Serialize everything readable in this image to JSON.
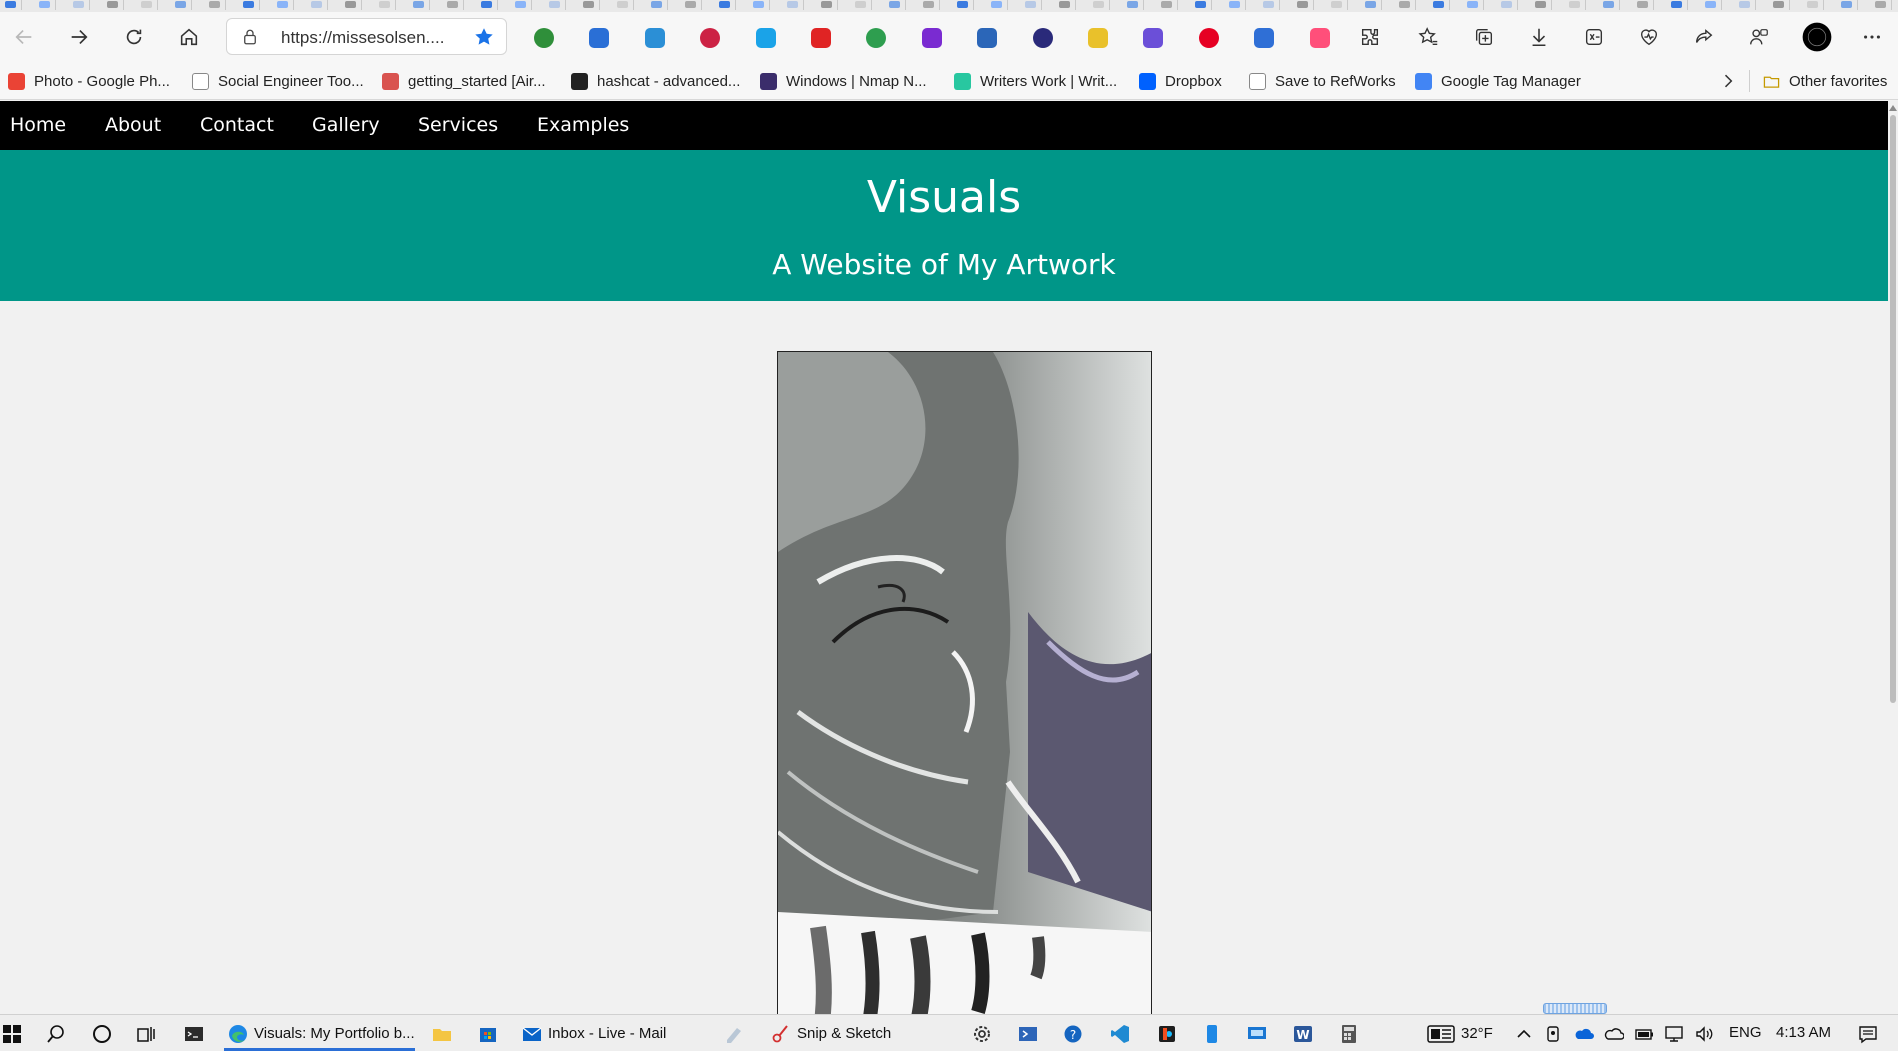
{
  "browser": {
    "url": "https://missesolsen....",
    "favorites": [
      {
        "label": "Photo - Google Ph...",
        "color": "#ea4335"
      },
      {
        "label": "Social Engineer Too...",
        "color": "#ffffff"
      },
      {
        "label": "getting_started [Air...",
        "color": "#d9534f"
      },
      {
        "label": "hashcat - advanced...",
        "color": "#222222"
      },
      {
        "label": "Windows | Nmap N...",
        "color": "#3b2d6b"
      },
      {
        "label": "Writers Work | Writ...",
        "color": "#28c7a0"
      },
      {
        "label": "Dropbox",
        "color": "#0061fe"
      },
      {
        "label": "Save to RefWorks",
        "color": "#ffffff"
      },
      {
        "label": "Google Tag Manager",
        "color": "#4285f4"
      }
    ],
    "other_favorites": "Other favorites",
    "extension_colors": [
      "#2f8f3a",
      "#2a6fd6",
      "#2b8fd6",
      "#cc2244",
      "#1aa3e8",
      "#e02424",
      "#2e9e4f",
      "#7a2bd1",
      "#2b66b8",
      "#2a2a7a",
      "#e9c12b",
      "#6b4fd8",
      "#e60023",
      "#2f6fd6",
      "#ff4f7a"
    ]
  },
  "nav": {
    "items": [
      "Home",
      "About",
      "Contact",
      "Gallery",
      "Services",
      "Examples"
    ]
  },
  "header": {
    "title": "Visuals",
    "subtitle": "A Website of My Artwork"
  },
  "taskbar": {
    "edge_window": "Visuals: My Portfolio b...",
    "mail_window": "Inbox - Live - Mail",
    "snip_window": "Snip & Sketch",
    "temperature": "32°F",
    "language": "ENG",
    "time": "4:13 AM"
  },
  "colors": {
    "accent": "#009688",
    "nav_bg": "#000000",
    "page_bg": "#f1f1f1"
  }
}
